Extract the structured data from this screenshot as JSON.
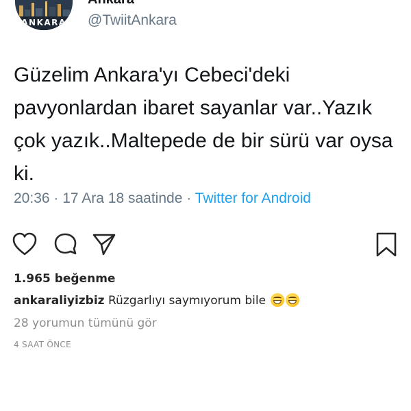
{
  "tweet": {
    "display_name": "Ankara",
    "handle": "@TwiitAnkara",
    "avatar_text": "ANKARA",
    "text": "Güzelim Ankara'yı Cebeci'deki pavyonlardan ibaret sayanlar var..Yazık çok yazık..Maltepede de bir sürü var oysa ki.",
    "time": "20:36",
    "date": "17 Ara 18 saatinde",
    "separator": " · ",
    "source": "Twitter for Android"
  },
  "post": {
    "likes": "1.965 beğenme",
    "caption_user": "ankaraliyizbiz",
    "caption_text": "Rüzgarlıyı saymıyorum bile",
    "caption_emoji": [
      "grinning-sweat-emoji",
      "grinning-sweat-emoji"
    ],
    "view_comments": "28 yorumun tümünü gör",
    "time_ago": "4 SAAT ÖNCE"
  },
  "icons": {
    "like": "heart-icon",
    "comment": "comment-icon",
    "share": "send-icon",
    "save": "bookmark-icon"
  },
  "colors": {
    "tweet_text": "#14171a",
    "tweet_meta": "#657786",
    "twitter_link": "#1da1f2",
    "ig_text": "#262626",
    "ig_muted": "#8e8e8e"
  }
}
